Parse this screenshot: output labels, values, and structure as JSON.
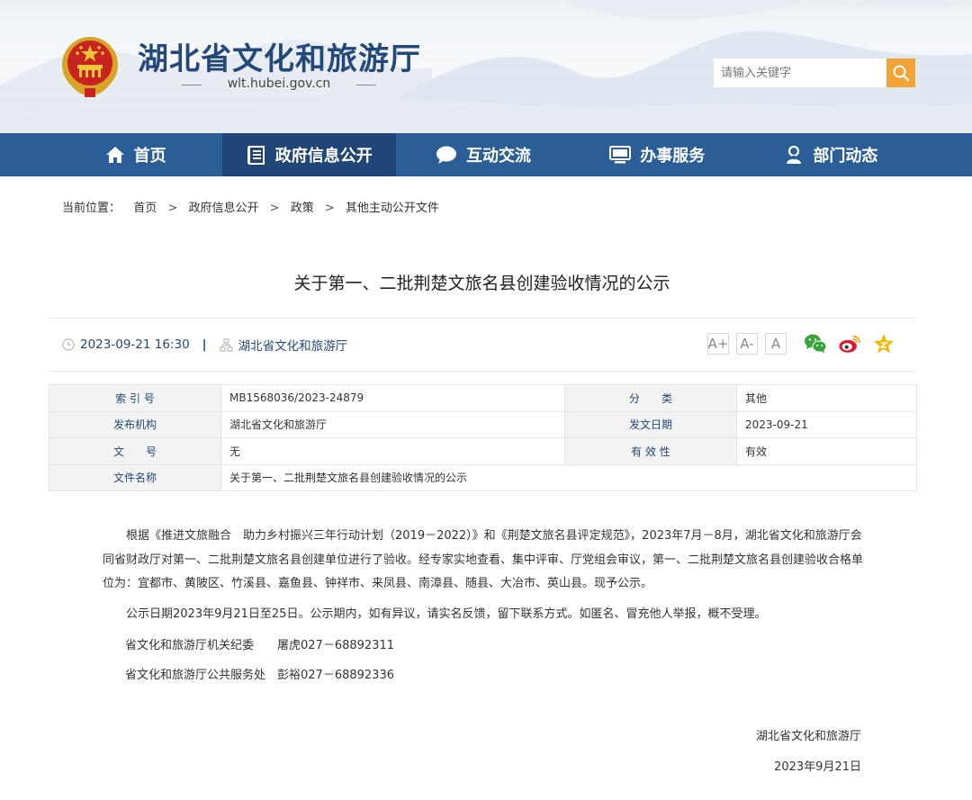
{
  "header": {
    "title": "湖北省文化和旅游厅",
    "url": "wlt.hubei.gov.cn",
    "search_placeholder": "请输入关键字"
  },
  "nav": {
    "items": [
      {
        "label": "首页",
        "icon": "home-icon"
      },
      {
        "label": "政府信息公开",
        "icon": "document-list-icon",
        "active": true
      },
      {
        "label": "互动交流",
        "icon": "chat-bubble-icon"
      },
      {
        "label": "办事服务",
        "icon": "monitor-icon"
      },
      {
        "label": "部门动态",
        "icon": "person-icon"
      }
    ]
  },
  "breadcrumb": {
    "prefix": "当前位置：",
    "items": [
      "首页",
      "政府信息公开",
      "政策",
      "其他主动公开文件"
    ],
    "separator": ">"
  },
  "article": {
    "title": "关于第一、二批荆楚文旅名县创建验收情况的公示",
    "datetime": "2023-09-21 16:30",
    "divider": "|",
    "publisher": "湖北省文化和旅游厅",
    "font_sizes": [
      "A+",
      "A-",
      "A"
    ],
    "share_icons": [
      "wechat-icon",
      "weibo-icon",
      "qzone-icon"
    ]
  },
  "info_table": {
    "rows": [
      {
        "k1": "索 引 号",
        "v1": "MB1568036/2023-24879",
        "k2": "分　　类",
        "v2": "其他"
      },
      {
        "k1": "发布机构",
        "v1": "湖北省文化和旅游厅",
        "k2": "发文日期",
        "v2": "2023-09-21"
      },
      {
        "k1": "文　　号",
        "v1": "无",
        "k2": "有 效 性",
        "v2": "有效"
      }
    ],
    "name_label": "文件名称",
    "name_value": "关于第一、二批荆楚文旅名县创建验收情况的公示"
  },
  "body": {
    "para1": "根据《推进文旅融合　助力乡村振兴三年行动计划（2019－2022）》和《荆楚文旅名县评定规范》，2023年7月－8月，湖北省文化和旅游厅会同省财政厅对第一、二批荆楚文旅名县创建单位进行了验收。经专家实地查看、集中评审、厅党组会审议，第一、二批荆楚文旅名县创建验收合格单位为：宜都市、黄陂区、竹溪县、嘉鱼县、钟祥市、来凤县、南漳县、随县、大冶市、英山县。现予公示。",
    "para2": "公示日期2023年9月21日至25日。公示期内，如有异议，请实名反馈，留下联系方式。如匿名、冒充他人举报，概不受理。",
    "contact1": "省文化和旅游厅机关纪委　　屠虎027－68892311",
    "contact2": "省文化和旅游厅公共服务处　彭裕027－68892336",
    "sign_org": "湖北省文化和旅游厅",
    "sign_date": "2023年9月21日"
  },
  "colors": {
    "brand_blue": "#2b5d96",
    "nav_active": "#1f4677",
    "title_blue": "#23487a",
    "search_orange": "#f2a335"
  }
}
